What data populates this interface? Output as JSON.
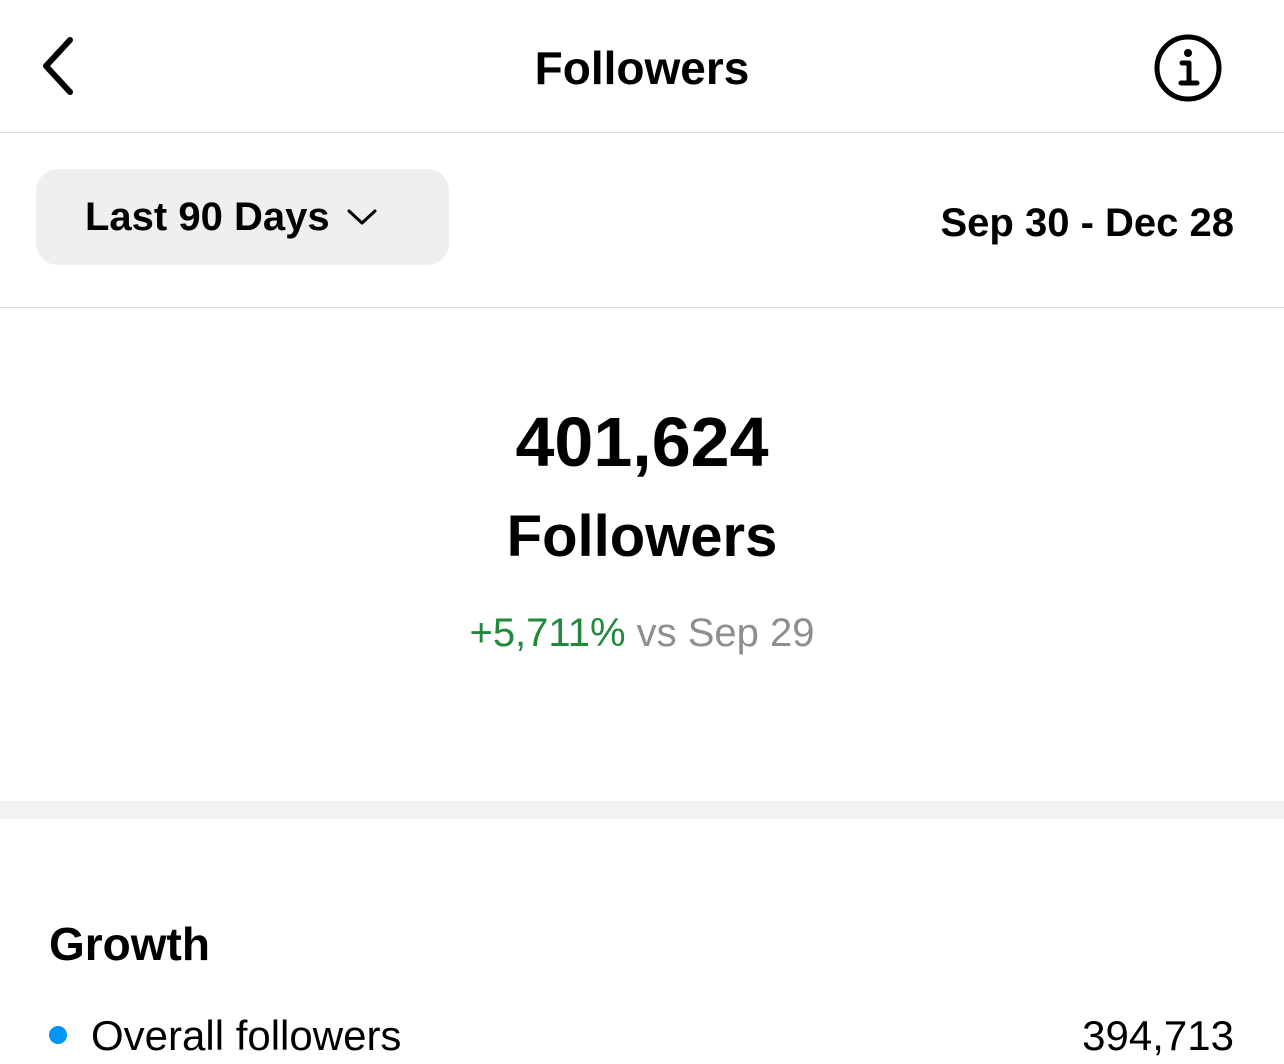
{
  "header": {
    "title": "Followers",
    "back_icon": "chevron-left-icon",
    "info_icon": "info-icon"
  },
  "filter": {
    "range_label": "Last 90 Days",
    "range_icon": "chevron-down-icon",
    "date_range": "Sep 30 - Dec 28"
  },
  "summary": {
    "total": "401,624",
    "label": "Followers",
    "change_pct": "+5,711%",
    "change_vs": "vs Sep 29",
    "change_color": "#1f8a3a"
  },
  "growth": {
    "title": "Growth",
    "rows": [
      {
        "label": "Overall followers",
        "value": "394,713",
        "dot_color": "#0095f6"
      }
    ]
  }
}
